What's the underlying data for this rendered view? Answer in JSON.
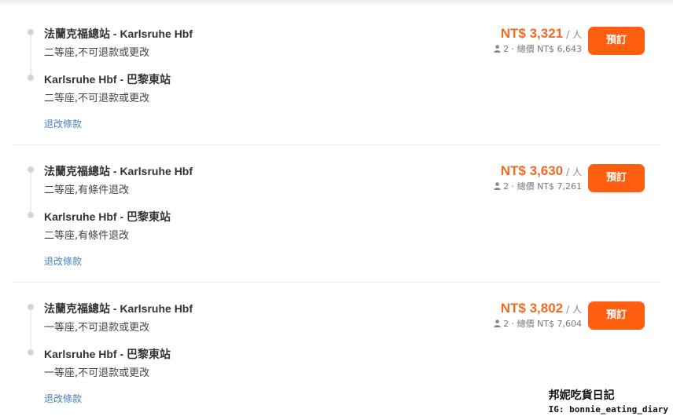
{
  "offers": [
    {
      "legs": [
        {
          "route": "法蘭克福總站 - Karlsruhe Hbf",
          "seat": "二等座,不可退款或更改"
        },
        {
          "route": "Karlsruhe Hbf - 巴黎東站",
          "seat": "二等座,不可退款或更改"
        }
      ],
      "policy_link": "退改條款",
      "price": "NT$ 3,321",
      "per_person": "/ 人",
      "total": "2 · 總價 NT$ 6,643",
      "book_label": "預訂"
    },
    {
      "legs": [
        {
          "route": "法蘭克福總站 - Karlsruhe Hbf",
          "seat": "二等座,有條件退改"
        },
        {
          "route": "Karlsruhe Hbf - 巴黎東站",
          "seat": "二等座,有條件退改"
        }
      ],
      "policy_link": "退改條款",
      "price": "NT$ 3,630",
      "per_person": "/ 人",
      "total": "2 · 總價 NT$ 7,261",
      "book_label": "預訂"
    },
    {
      "legs": [
        {
          "route": "法蘭克福總站 - Karlsruhe Hbf",
          "seat": "一等座,不可退款或更改"
        },
        {
          "route": "Karlsruhe Hbf - 巴黎東站",
          "seat": "一等座,不可退款或更改"
        }
      ],
      "policy_link": "退改條款",
      "price": "NT$ 3,802",
      "per_person": "/ 人",
      "total": "2 · 總價 NT$ 7,604",
      "book_label": "預訂"
    }
  ],
  "watermark": {
    "title": "邦妮吃貨日記",
    "ig": "IG: bonnie_eating_diary"
  },
  "colors": {
    "price": "#ef6a23",
    "book_button": "#fd5e0f",
    "link": "#4a7fc1"
  },
  "icons": {
    "passenger": "person-icon"
  }
}
